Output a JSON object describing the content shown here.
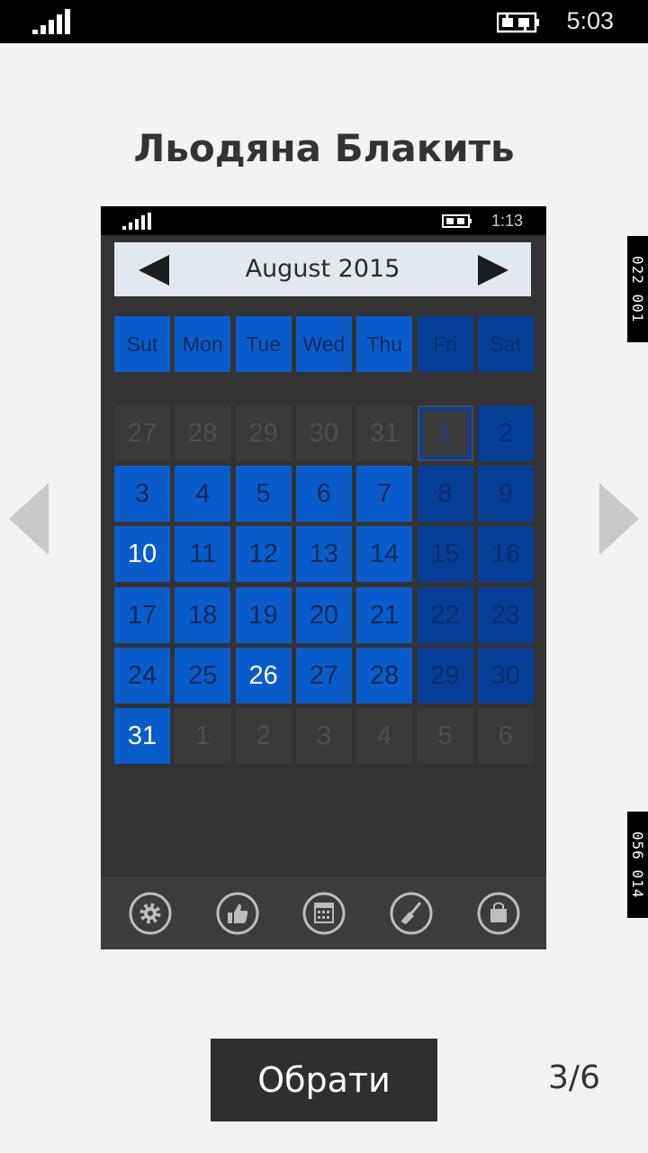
{
  "status_bar": {
    "time": "5:03",
    "icons": [
      "signal-icon",
      "battery-charging-icon"
    ]
  },
  "title": "Льодяна Блакить",
  "preview": {
    "status_bar": {
      "time": "1:13"
    },
    "month_label": "August 2015",
    "weekdays": [
      {
        "label": "Sut",
        "weekend": false
      },
      {
        "label": "Mon",
        "weekend": false
      },
      {
        "label": "Tue",
        "weekend": false
      },
      {
        "label": "Wed",
        "weekend": false
      },
      {
        "label": "Thu",
        "weekend": false
      },
      {
        "label": "Fri",
        "weekend": true
      },
      {
        "label": "Sat",
        "weekend": true
      }
    ],
    "weeks": [
      [
        {
          "d": "27",
          "s": "other"
        },
        {
          "d": "28",
          "s": "other"
        },
        {
          "d": "29",
          "s": "other"
        },
        {
          "d": "30",
          "s": "other"
        },
        {
          "d": "31",
          "s": "other"
        },
        {
          "d": "1",
          "s": "today"
        },
        {
          "d": "2",
          "s": "weekend"
        }
      ],
      [
        {
          "d": "3",
          "s": "weekday"
        },
        {
          "d": "4",
          "s": "weekday"
        },
        {
          "d": "5",
          "s": "weekday"
        },
        {
          "d": "6",
          "s": "weekday"
        },
        {
          "d": "7",
          "s": "weekday"
        },
        {
          "d": "8",
          "s": "weekend"
        },
        {
          "d": "9",
          "s": "weekend"
        }
      ],
      [
        {
          "d": "10",
          "s": "weekday",
          "hl": true
        },
        {
          "d": "11",
          "s": "weekday"
        },
        {
          "d": "12",
          "s": "weekday"
        },
        {
          "d": "13",
          "s": "weekday"
        },
        {
          "d": "14",
          "s": "weekday"
        },
        {
          "d": "15",
          "s": "weekend"
        },
        {
          "d": "16",
          "s": "weekend"
        }
      ],
      [
        {
          "d": "17",
          "s": "weekday"
        },
        {
          "d": "18",
          "s": "weekday"
        },
        {
          "d": "19",
          "s": "weekday"
        },
        {
          "d": "20",
          "s": "weekday"
        },
        {
          "d": "21",
          "s": "weekday"
        },
        {
          "d": "22",
          "s": "weekend"
        },
        {
          "d": "23",
          "s": "weekend"
        }
      ],
      [
        {
          "d": "24",
          "s": "weekday"
        },
        {
          "d": "25",
          "s": "weekday"
        },
        {
          "d": "26",
          "s": "weekday",
          "hl": true
        },
        {
          "d": "27",
          "s": "weekday"
        },
        {
          "d": "28",
          "s": "weekday"
        },
        {
          "d": "29",
          "s": "weekend"
        },
        {
          "d": "30",
          "s": "weekend"
        }
      ],
      [
        {
          "d": "31",
          "s": "weekday",
          "hl": true
        },
        {
          "d": "1",
          "s": "other"
        },
        {
          "d": "2",
          "s": "other"
        },
        {
          "d": "3",
          "s": "other"
        },
        {
          "d": "4",
          "s": "other"
        },
        {
          "d": "5",
          "s": "other"
        },
        {
          "d": "6",
          "s": "other"
        }
      ]
    ],
    "toolbar_icons": [
      "settings-icon",
      "thumbs-up-icon",
      "calendar-icon",
      "brush-icon",
      "store-bag-icon"
    ],
    "colors": {
      "weekday": "#0a5ccb",
      "weekend": "#073f97",
      "other": "#3a3a3a",
      "background": "#333333",
      "weekday_text": "#0b2a57",
      "weekend_text": "#062d6b",
      "other_text": "#4f4f4f",
      "highlight_text": "#ffffff"
    }
  },
  "side_tags": [
    "022 001",
    "056 014"
  ],
  "choose_button": "Обрати",
  "page_counter": "3/6",
  "nav_icons": [
    "previous-arrow-icon",
    "next-arrow-icon"
  ]
}
